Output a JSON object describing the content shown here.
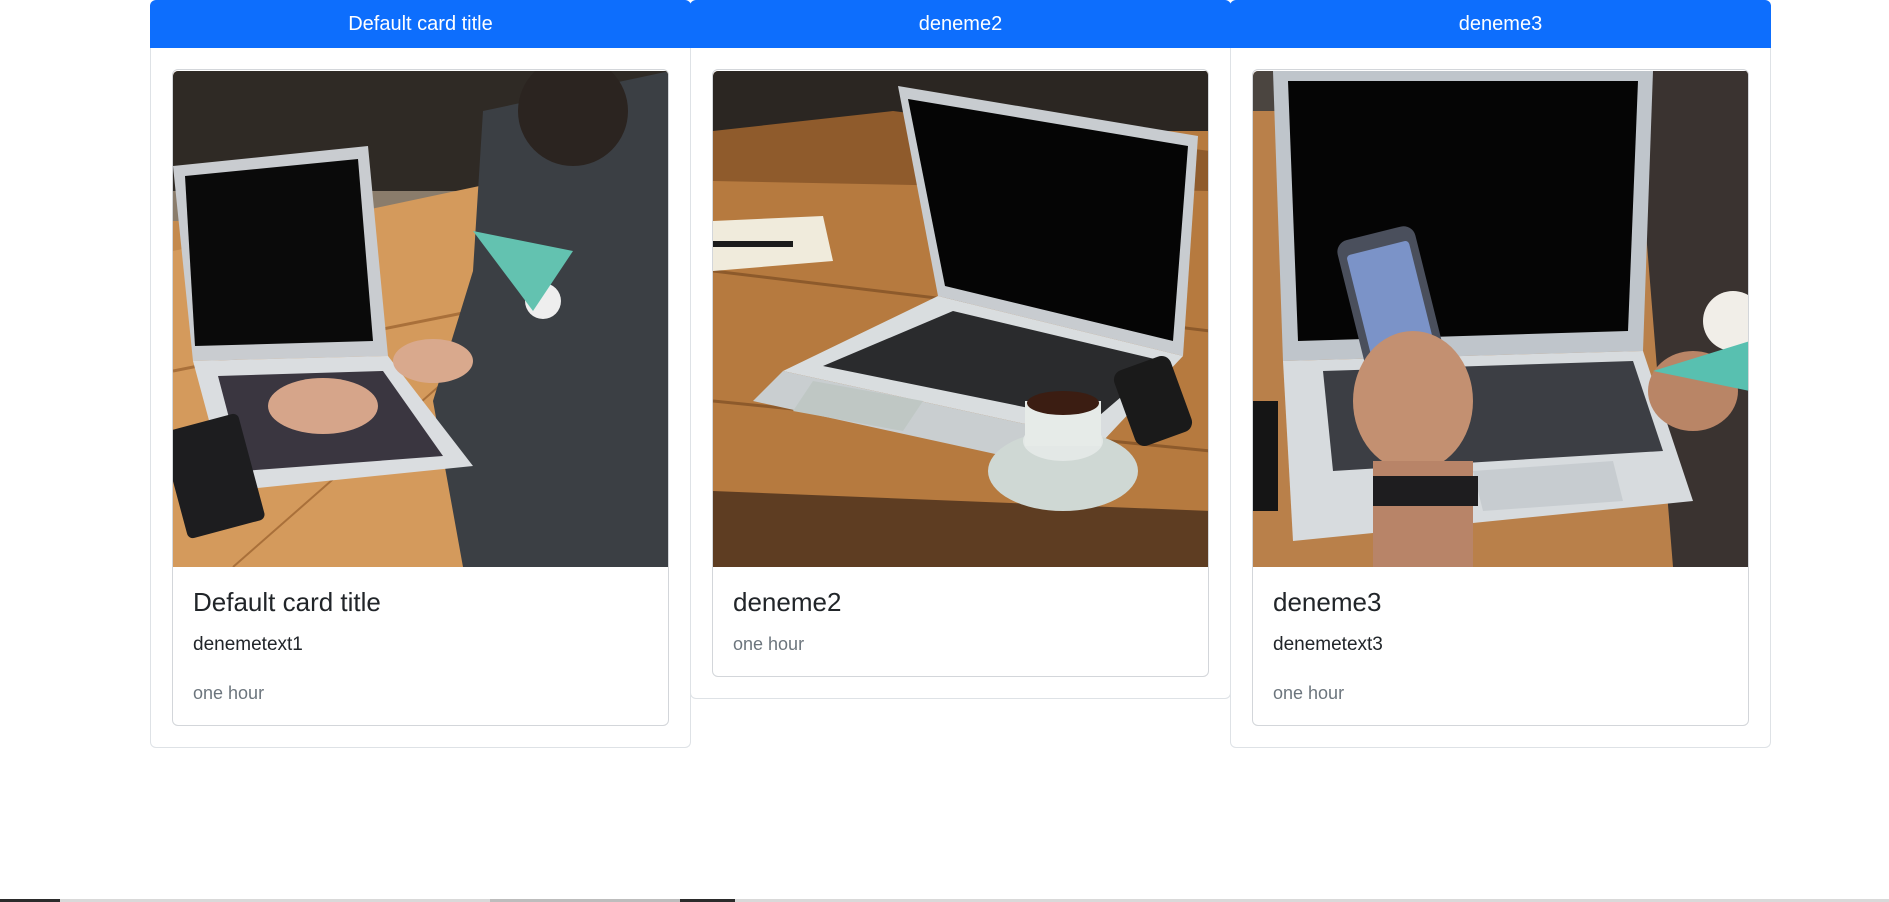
{
  "columns": [
    {
      "header": "Default card title",
      "title": "Default card title",
      "text": "denemetext1",
      "meta": "one hour",
      "image_icon": "laptop-typing-photo-icon"
    },
    {
      "header": "deneme2",
      "title": "deneme2",
      "meta": "one hour",
      "image_icon": "laptop-coffee-photo-icon"
    },
    {
      "header": "deneme3",
      "title": "deneme3",
      "text": "denemetext3",
      "meta": "one hour",
      "image_icon": "laptop-phone-photo-icon"
    }
  ],
  "colors": {
    "header_bg": "#0d6efd",
    "header_text": "#ffffff",
    "muted_text": "#6c757d",
    "border": "#dee2e6"
  }
}
